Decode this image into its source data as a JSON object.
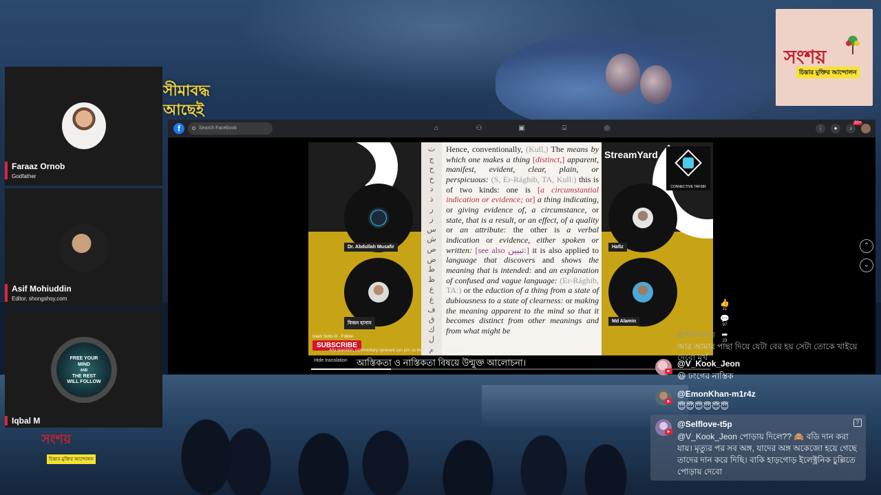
{
  "background": {
    "bangla_lines": [
      "সীমাবদ্ধ",
      "আছেই"
    ]
  },
  "logo": {
    "name": "সংশয়",
    "tagline": "চিন্তার মুক্তির আন্দোলন"
  },
  "participants": [
    {
      "name": "Faraaz Ornob",
      "role": "Godfather",
      "avatar": "person-photo"
    },
    {
      "name": "Asif Mohiuddin",
      "role": "Editor, shongshoy.com",
      "avatar": "person-photo"
    },
    {
      "name": "Iqbal M",
      "role": "",
      "avatar": "free-your-mind-image",
      "avatar_text": [
        "FREE YOUR",
        "MIND",
        "AND",
        "THE REST",
        "WILL FOLLOW"
      ]
    }
  ],
  "facebook": {
    "search_placeholder": "Search Facebook",
    "nav_icons": [
      "home-icon",
      "friends-icon",
      "watch-icon",
      "marketplace-icon",
      "gaming-icon"
    ],
    "right_icons": [
      "menu-grid-icon",
      "messenger-icon",
      "notifications-icon",
      "profile-avatar"
    ],
    "notification_badge": "20+"
  },
  "stream": {
    "branding": "StreamYard",
    "channel_logo_label": "CONNECTIVE TAFSIR",
    "speakers": [
      "Dr. Abdullah Musafir",
      "বিজন হাসান",
      "Hafiz",
      "Md Alamin"
    ],
    "page_tag": "Islam Sotto G · Follow",
    "subscribe_label": "SUBSCRIBE",
    "promo_text": "Any question, commentary, ignorant can join us live and join the discussion!",
    "document": {
      "arabic_letters": [
        "ت",
        "ج",
        "ح",
        "خ",
        "د",
        "ذ",
        "ر",
        "ز",
        "س",
        "ش",
        "ص",
        "ض",
        "ط",
        "ظ",
        "ع",
        "غ",
        "ف",
        "ق",
        "ك",
        "ل",
        "م"
      ],
      "text_html": "Hence, conventionally, <span class=\"gray\">(Kull,)</span> The <i>means by which one makes a thing</i> <span class=\"red\">[<i>distinct,</i>]</i></span> <i>apparent, manifest, evident, clear, plain, or perspicuous:</i> <span class=\"gray\">(S, Er-Rághib, TA, Kull:)</span> this is of two kinds: one is <span class=\"red\">[<i>a circumstantial indication or evidence;</i> or]</span> <i>a thing indicating,</i> or <i>giving evidence of, a circumstance,</i> or <i>state, that is a result, or an effect, of a quality</i> or <i>an attribute:</i> the other is <i>a verbal indication</i> or <i>evidence, either spoken or written:</i> <span class=\"purple\">[see also تبيين:]</span> it is also applied to <i>language that discovers</i> and <i>shows the meaning that is intended:</i> and <i>an explanation of confused and vague language:</i> <span class=\"gray\">(Er-Rághib, TA:)</span> or the <i>eduction of a thing from a state of dubiousness to a state of clearness:</i> or <i>making the meaning apparent to the mind so that it becomes distinct from other meanings and from what might be</i>"
    },
    "hide_translation": "Hide translation",
    "caption": "আস্তিকতা ও নাস্তিকতা বিষয়ে উন্মুক্ত আলোচনা।",
    "progress": 0.2,
    "reactions": [
      {
        "icon": "like-icon",
        "count": "21"
      },
      {
        "icon": "comment-icon",
        "count": "97"
      },
      {
        "icon": "share-icon",
        "count": "23"
      }
    ]
  },
  "chat": {
    "faded": {
      "username": "@জীবনতত্ত্ব",
      "message": "আর আমার পাছা দিয়ে যেটা বের হয় সেটা তোকে খাইয়ে দেবো মূর্খ"
    },
    "messages": [
      {
        "username": "@V_Kook_Jeon",
        "text": "😃 ঢংগের নাস্তিক"
      },
      {
        "username": "@EmonKhan-m1r4z",
        "text": "😇😇😇😇😇😇"
      },
      {
        "username": "@Selflove-t5p",
        "text": "@V_Kook_Jeon পোড়ায় দিলে?? 🙈 বডি দান করা যায়। মৃত্যুর পর সব অঙ্গ, যাদের অঙ্গ অকেজো হয়ে গেছে তাদের দান করে দিছি। বাকি হাড়গোড় ইলেক্ট্রনিক চুল্লিতে পোড়ায় দেবো"
      }
    ]
  }
}
